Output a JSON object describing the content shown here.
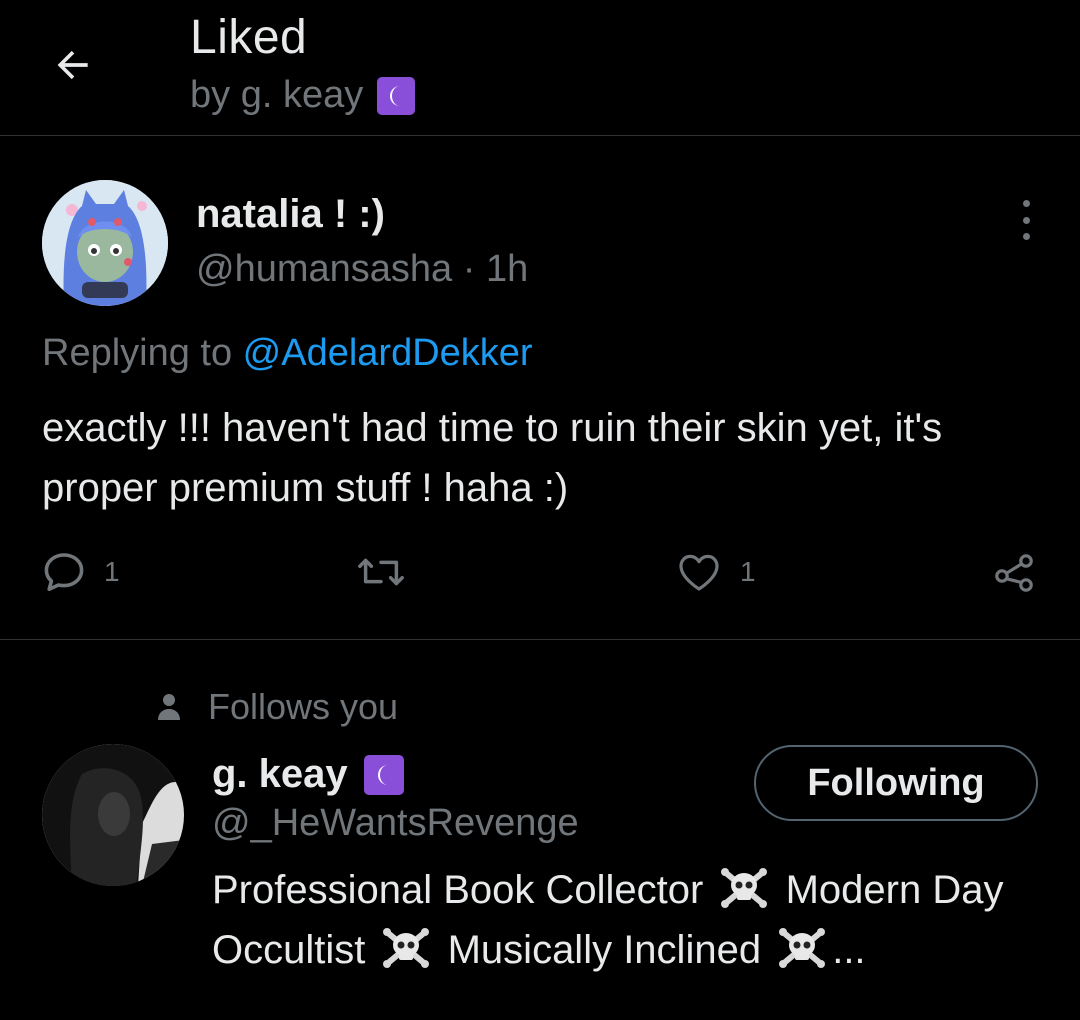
{
  "header": {
    "title": "Liked",
    "subtitle": "by g. keay",
    "back_icon": "arrow-left-icon",
    "badge_icon": "crescent-moon-icon"
  },
  "tweet": {
    "display_name": "natalia ! :)",
    "handle": "@humansasha",
    "separator": " · ",
    "time": "1h",
    "replying_prefix": "Replying to ",
    "replying_to": "@AdelardDekker",
    "text": "exactly !!! haven't had time to ruin their skin yet, it's proper premium stuff ! haha :)",
    "actions": {
      "reply_count": "1",
      "retweet_count": "",
      "like_count": "1"
    }
  },
  "user_cell": {
    "follows_you": "Follows you",
    "display_name": "g. keay",
    "handle": "@_HeWantsRevenge",
    "follow_button": "Following",
    "bio": {
      "seg1": "Professional Book Collector",
      "seg2": "Modern Day Occultist",
      "seg3": "Musically Inclined",
      "ellipsis": "..."
    }
  },
  "colors": {
    "background": "#000000",
    "text": "#e7e9ea",
    "secondary": "#71767b",
    "link": "#1d9bf0",
    "divider": "#2f3336",
    "badge": "#8a4fd8"
  }
}
